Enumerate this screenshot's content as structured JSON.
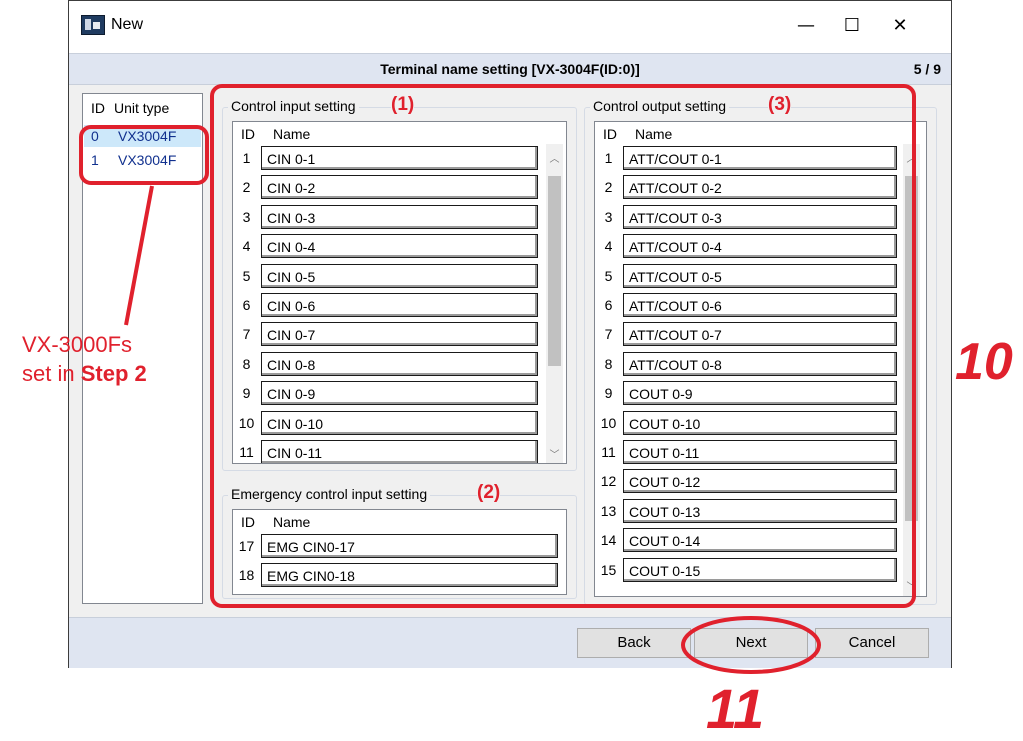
{
  "window": {
    "title": "New",
    "minimize_glyph": "—",
    "maximize_glyph": "☐",
    "close_glyph": "✕"
  },
  "header": {
    "title": "Terminal name setting [VX-3004F(ID:0)]",
    "page_counter": "5 / 9"
  },
  "unit_list": {
    "col_id": "ID",
    "col_type": "Unit type",
    "rows": [
      {
        "id": "0",
        "type": "VX3004F",
        "selected": true
      },
      {
        "id": "1",
        "type": "VX3004F",
        "selected": false
      }
    ]
  },
  "control_input": {
    "label": "Control input setting",
    "col_id": "ID",
    "col_name": "Name",
    "rows": [
      {
        "id": "1",
        "name": "CIN 0-1"
      },
      {
        "id": "2",
        "name": "CIN 0-2"
      },
      {
        "id": "3",
        "name": "CIN 0-3"
      },
      {
        "id": "4",
        "name": "CIN 0-4"
      },
      {
        "id": "5",
        "name": "CIN 0-5"
      },
      {
        "id": "6",
        "name": "CIN 0-6"
      },
      {
        "id": "7",
        "name": "CIN 0-7"
      },
      {
        "id": "8",
        "name": "CIN 0-8"
      },
      {
        "id": "9",
        "name": "CIN 0-9"
      },
      {
        "id": "10",
        "name": "CIN 0-10"
      },
      {
        "id": "11",
        "name": "CIN 0-11"
      }
    ]
  },
  "emergency_input": {
    "label": "Emergency control input setting",
    "col_id": "ID",
    "col_name": "Name",
    "rows": [
      {
        "id": "17",
        "name": "EMG CIN0-17"
      },
      {
        "id": "18",
        "name": "EMG CIN0-18"
      }
    ]
  },
  "control_output": {
    "label": "Control output setting",
    "col_id": "ID",
    "col_name": "Name",
    "rows": [
      {
        "id": "1",
        "name": "ATT/COUT 0-1"
      },
      {
        "id": "2",
        "name": "ATT/COUT 0-2"
      },
      {
        "id": "3",
        "name": "ATT/COUT 0-3"
      },
      {
        "id": "4",
        "name": "ATT/COUT 0-4"
      },
      {
        "id": "5",
        "name": "ATT/COUT 0-5"
      },
      {
        "id": "6",
        "name": "ATT/COUT 0-6"
      },
      {
        "id": "7",
        "name": "ATT/COUT 0-7"
      },
      {
        "id": "8",
        "name": "ATT/COUT 0-8"
      },
      {
        "id": "9",
        "name": "COUT 0-9"
      },
      {
        "id": "10",
        "name": "COUT 0-10"
      },
      {
        "id": "11",
        "name": "COUT 0-11"
      },
      {
        "id": "12",
        "name": "COUT 0-12"
      },
      {
        "id": "13",
        "name": "COUT 0-13"
      },
      {
        "id": "14",
        "name": "COUT 0-14"
      },
      {
        "id": "15",
        "name": "COUT 0-15"
      }
    ]
  },
  "buttons": {
    "back": "Back",
    "next": "Next",
    "cancel": "Cancel"
  },
  "annotations": {
    "marker_1": "(1)",
    "marker_2": "(2)",
    "marker_3": "(3)",
    "step_10": "10",
    "step_11": "11",
    "note_line1": "VX-3000Fs",
    "note_line2_prefix": "set in ",
    "note_line2_bold": "Step 2",
    "color": "#e0212d"
  }
}
